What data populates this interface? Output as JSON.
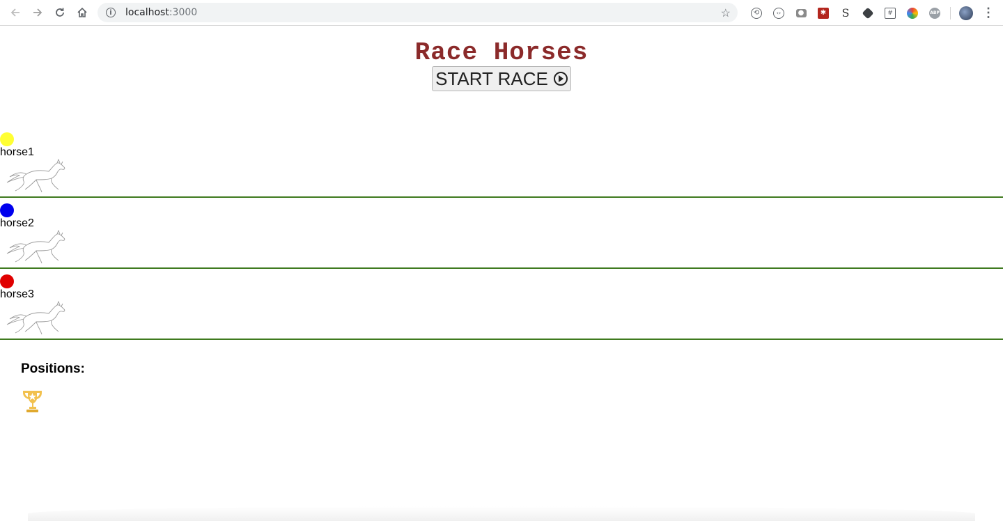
{
  "browser": {
    "url_host": "localhost",
    "url_port": ":3000"
  },
  "page": {
    "title": "Race Horses",
    "start_button_label": "START RACE",
    "positions_label": "Positions:"
  },
  "lanes": [
    {
      "name": "horse1",
      "color": "#ffff33"
    },
    {
      "name": "horse2",
      "color": "#0000ee"
    },
    {
      "name": "horse3",
      "color": "#e00000"
    }
  ],
  "colors": {
    "title": "#8b2a2a",
    "lane_border": "#3f7a1f",
    "trophy": "#f2c14e"
  },
  "icons": {
    "back": "back-arrow-icon",
    "forward": "forward-arrow-icon",
    "reload": "reload-icon",
    "home": "home-icon",
    "info": "info-icon",
    "bookmark": "star-icon",
    "play": "play-circle-icon",
    "horse": "horse-icon",
    "trophy": "trophy-icon"
  }
}
